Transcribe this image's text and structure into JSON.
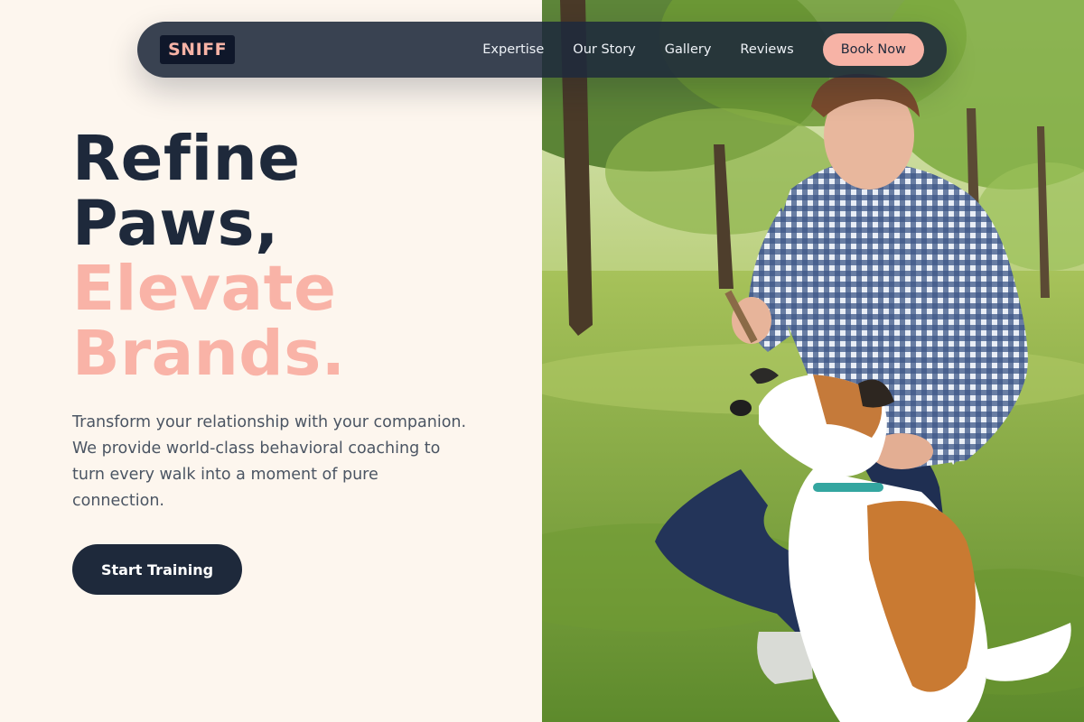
{
  "brand": {
    "logo_text": "SNIFF"
  },
  "nav": {
    "links": [
      "Expertise",
      "Our Story",
      "Gallery",
      "Reviews"
    ],
    "cta_label": "Book Now"
  },
  "hero": {
    "headline_line1": "Refine",
    "headline_line2": "Paws,",
    "headline_line3": "Elevate",
    "headline_line4": "Brands.",
    "description": "Transform your relationship with your companion. We provide world-class behavioral coaching to turn every walk into a moment of pure connection.",
    "cta_label": "Start Training"
  },
  "colors": {
    "cream_background": "#fdf6ee",
    "navy": "#1e293b",
    "peach_accent": "#f9b3a7",
    "body_text": "#4b5563"
  },
  "photo": {
    "alt": "hero-photo-man-training-dog-in-park"
  }
}
